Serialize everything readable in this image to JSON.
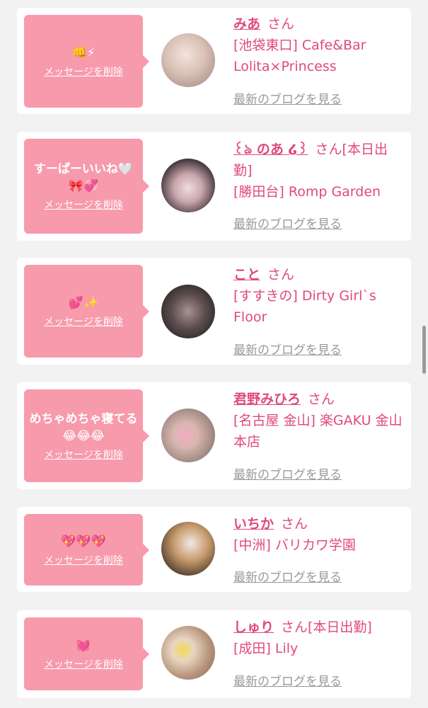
{
  "entries": [
    {
      "message": "👊⚡",
      "delete_label": "メッセージを削除",
      "name": "みあ",
      "suffix": "さん",
      "shop": "[池袋東口] Cafe&Bar Lolita×Princess",
      "blog_label": "最新のブログを見る",
      "avatar_colors": [
        "#e9d7cf",
        "#b89a93"
      ]
    },
    {
      "message": "すーぱーいいね🤍🎀💞",
      "delete_label": "メッセージを削除",
      "name": "꒰ঌ のあ ໒꒱",
      "suffix": "さん[本日出勤]",
      "shop": "[勝田台] Romp Garden",
      "blog_label": "最新のブログを見る",
      "avatar_colors": [
        "#3a2f35",
        "#e8cfd3"
      ]
    },
    {
      "message": "💕✨",
      "delete_label": "メッセージを削除",
      "name": "こと",
      "suffix": "さん",
      "shop": "[すすきの] Dirty Girl`s Floor",
      "blog_label": "最新のブログを見る",
      "avatar_colors": [
        "#2b2426",
        "#9e8a86"
      ]
    },
    {
      "message": "めちゃめちゃ寝てる😂😂😂",
      "delete_label": "メッセージを削除",
      "name": "君野みひろ",
      "suffix": "さん",
      "shop": "[名古屋 金山] 楽GAKU 金山本店",
      "blog_label": "最新のブログを見る",
      "avatar_colors": [
        "#c9b0a8",
        "#8a7670"
      ]
    },
    {
      "message": "💖💖💖",
      "delete_label": "メッセージを削除",
      "name": "いちか",
      "suffix": "さん",
      "shop": "[中洲] バリカワ学園",
      "blog_label": "最新のブログを見る",
      "avatar_colors": [
        "#3d2c24",
        "#c59a6b"
      ]
    },
    {
      "message": "💓",
      "delete_label": "メッセージを削除",
      "name": "しゅり",
      "suffix": "さん[本日出勤]",
      "shop": "[成田] Lily",
      "blog_label": "最新のブログを見る",
      "avatar_colors": [
        "#d9c7b4",
        "#8b6a52"
      ]
    }
  ]
}
